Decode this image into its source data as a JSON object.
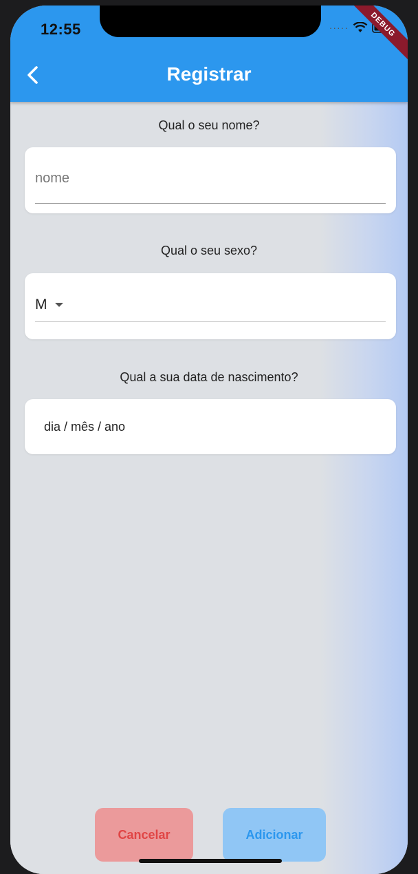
{
  "status_bar": {
    "time": "12:55",
    "debug_label": "DEBUG"
  },
  "appbar": {
    "title": "Registrar",
    "back_icon": "chevron-left-icon",
    "color": "#2c97ee"
  },
  "form": {
    "name": {
      "question": "Qual o seu nome?",
      "placeholder": "nome",
      "value": ""
    },
    "sex": {
      "question": "Qual o seu sexo?",
      "selected": "M"
    },
    "birthdate": {
      "question": "Qual a sua data de nascimento?",
      "value": "dia / mês / ano"
    }
  },
  "buttons": {
    "cancel": "Cancelar",
    "add": "Adicionar"
  }
}
